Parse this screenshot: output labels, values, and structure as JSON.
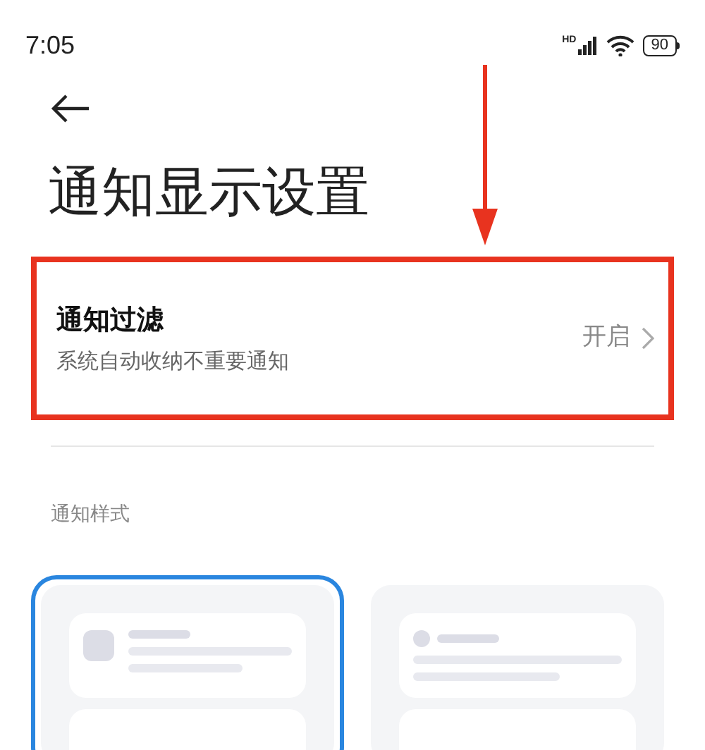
{
  "status_bar": {
    "time": "7:05",
    "network_label": "HD",
    "battery": "90"
  },
  "title": "通知显示设置",
  "setting": {
    "title": "通知过滤",
    "subtitle": "系统自动收纳不重要通知",
    "value": "开启",
    "highlighted": true
  },
  "section_header": "通知样式",
  "style_options": [
    {
      "kind": "square_icon",
      "selected": true
    },
    {
      "kind": "round_icon",
      "selected": false
    }
  ]
}
